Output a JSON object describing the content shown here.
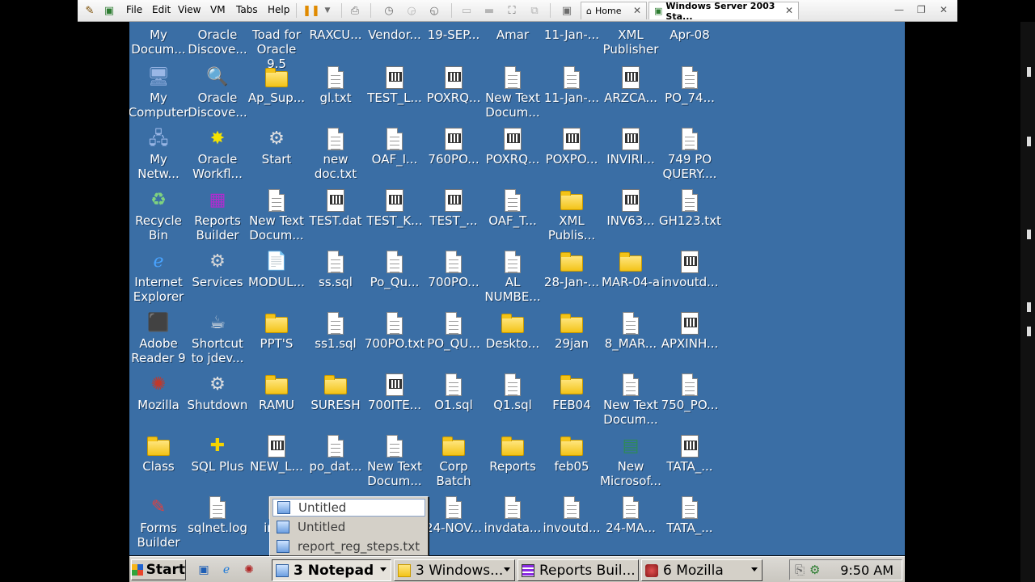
{
  "vm_window": {
    "menus": [
      "File",
      "Edit",
      "View",
      "VM",
      "Tabs",
      "Help"
    ],
    "tabs": [
      {
        "label": "Home"
      },
      {
        "label": "Windows Server 2003 Sta..."
      }
    ]
  },
  "desktop": {
    "icons": [
      {
        "label": "My\nDocum...",
        "icon": "my-documents-icon"
      },
      {
        "label": "Oracle\nDiscove...",
        "icon": "oracle-discoverer-icon"
      },
      {
        "label": "Toad for\nOracle 9.5",
        "icon": "toad-icon"
      },
      {
        "label": "RAXCU...",
        "icon": "file-icon"
      },
      {
        "label": "Vendor...",
        "icon": "file-icon"
      },
      {
        "label": "19-SEP...",
        "icon": "file-icon"
      },
      {
        "label": "Amar",
        "icon": "folder-icon"
      },
      {
        "label": "11-Jan-...",
        "icon": "file-icon"
      },
      {
        "label": "XML\nPublisher",
        "icon": "folder-icon"
      },
      {
        "label": "Apr-08",
        "icon": "folder-icon"
      },
      {
        "label": "My\nComputer",
        "icon": "my-computer-icon"
      },
      {
        "label": "Oracle\nDiscove...",
        "icon": "oracle-discoverer-icon"
      },
      {
        "label": "Ap_Sup...",
        "icon": "folder-icon"
      },
      {
        "label": "gl.txt",
        "icon": "text-file-icon"
      },
      {
        "label": "TEST_L...",
        "icon": "form-file-icon"
      },
      {
        "label": "POXRQ...",
        "icon": "form-file-icon"
      },
      {
        "label": "New Text\nDocum...",
        "icon": "text-file-icon"
      },
      {
        "label": "11-Jan-...",
        "icon": "text-file-icon"
      },
      {
        "label": "ARZCA...",
        "icon": "form-file-icon"
      },
      {
        "label": "PO_74...",
        "icon": "text-file-icon"
      },
      {
        "label": "My\nNetw...",
        "icon": "my-network-icon"
      },
      {
        "label": "Oracle\nWorkfl...",
        "icon": "oracle-workflow-icon"
      },
      {
        "label": "Start",
        "icon": "batch-file-icon"
      },
      {
        "label": "new\ndoc.txt",
        "icon": "text-file-icon"
      },
      {
        "label": "OAF_I...",
        "icon": "text-file-icon"
      },
      {
        "label": "760PO...",
        "icon": "form-file-icon"
      },
      {
        "label": "POXRQ...",
        "icon": "form-file-icon"
      },
      {
        "label": "POXPO...",
        "icon": "form-file-icon"
      },
      {
        "label": "INVIRI...",
        "icon": "form-file-icon"
      },
      {
        "label": "749 PO\nQUERY....",
        "icon": "text-file-icon"
      },
      {
        "label": "Recycle\nBin",
        "icon": "recycle-bin-icon"
      },
      {
        "label": "Reports\nBuilder",
        "icon": "reports-builder-icon"
      },
      {
        "label": "New Text\nDocum...",
        "icon": "text-file-icon"
      },
      {
        "label": "TEST.dat",
        "icon": "form-file-icon"
      },
      {
        "label": "TEST_K...",
        "icon": "form-file-icon"
      },
      {
        "label": "TEST_...",
        "icon": "form-file-icon"
      },
      {
        "label": "OAF_T...",
        "icon": "text-file-icon"
      },
      {
        "label": "XML\nPublis...",
        "icon": "folder-icon"
      },
      {
        "label": "INV63...",
        "icon": "form-file-icon"
      },
      {
        "label": "GH123.txt",
        "icon": "text-file-icon"
      },
      {
        "label": "Internet\nExplorer",
        "icon": "internet-explorer-icon"
      },
      {
        "label": "Services",
        "icon": "services-icon"
      },
      {
        "label": "MODUL...",
        "icon": "pdf-file-icon"
      },
      {
        "label": "ss.sql",
        "icon": "text-file-icon"
      },
      {
        "label": "Po_Qu...",
        "icon": "text-file-icon"
      },
      {
        "label": "700PO...",
        "icon": "text-file-icon"
      },
      {
        "label": "AL\nNUMBE...",
        "icon": "text-file-icon"
      },
      {
        "label": "28-Jan-...",
        "icon": "folder-icon"
      },
      {
        "label": "MAR-04-a",
        "icon": "folder-icon"
      },
      {
        "label": "invoutd...",
        "icon": "form-file-icon"
      },
      {
        "label": "Adobe\nReader 9",
        "icon": "adobe-reader-icon"
      },
      {
        "label": "Shortcut\nto jdev...",
        "icon": "jdev-shortcut-icon"
      },
      {
        "label": "PPT'S",
        "icon": "folder-icon"
      },
      {
        "label": "ss1.sql",
        "icon": "text-file-icon"
      },
      {
        "label": "700PO.txt",
        "icon": "text-file-icon"
      },
      {
        "label": "PO_QU...",
        "icon": "text-file-icon"
      },
      {
        "label": "Deskto...",
        "icon": "folder-icon"
      },
      {
        "label": "29jan",
        "icon": "folder-icon"
      },
      {
        "label": "8_MAR...",
        "icon": "text-file-icon"
      },
      {
        "label": "APXINH...",
        "icon": "form-file-icon"
      },
      {
        "label": "Mozilla",
        "icon": "mozilla-icon"
      },
      {
        "label": "Shutdown",
        "icon": "batch-file-icon"
      },
      {
        "label": "RAMU",
        "icon": "folder-icon"
      },
      {
        "label": "SURESH",
        "icon": "folder-icon"
      },
      {
        "label": "700ITE...",
        "icon": "form-file-icon"
      },
      {
        "label": "O1.sql",
        "icon": "text-file-icon"
      },
      {
        "label": "Q1.sql",
        "icon": "text-file-icon"
      },
      {
        "label": "FEB04",
        "icon": "folder-icon"
      },
      {
        "label": "New Text\nDocum...",
        "icon": "text-file-icon"
      },
      {
        "label": "750_PO...",
        "icon": "text-file-icon"
      },
      {
        "label": "Class",
        "icon": "folder-icon"
      },
      {
        "label": "SQL Plus",
        "icon": "sql-plus-icon"
      },
      {
        "label": "NEW_L...",
        "icon": "form-file-icon"
      },
      {
        "label": "po_dat...",
        "icon": "text-file-icon"
      },
      {
        "label": "New Text\nDocum...",
        "icon": "text-file-icon"
      },
      {
        "label": "Corp\nBatch",
        "icon": "folder-icon"
      },
      {
        "label": "Reports",
        "icon": "folder-icon"
      },
      {
        "label": "feb05",
        "icon": "folder-icon"
      },
      {
        "label": "New\nMicrosof...",
        "icon": "excel-file-icon"
      },
      {
        "label": "TATA_...",
        "icon": "form-file-icon"
      },
      {
        "label": "Forms\nBuilder",
        "icon": "forms-builder-icon"
      },
      {
        "label": "sqlnet.log",
        "icon": "text-file-icon"
      },
      {
        "label": "invo",
        "icon": "text-file-icon"
      },
      {
        "label": "",
        "icon": "hidden"
      },
      {
        "label": "",
        "icon": "hidden"
      },
      {
        "label": "24-NOV...",
        "icon": "text-file-icon"
      },
      {
        "label": "invdata...",
        "icon": "text-file-icon"
      },
      {
        "label": "invoutd...",
        "icon": "text-file-icon"
      },
      {
        "label": "24-MA...",
        "icon": "text-file-icon"
      },
      {
        "label": "TATA_...",
        "icon": "text-file-icon"
      }
    ]
  },
  "popup": {
    "items": [
      {
        "label": "Untitled"
      },
      {
        "label": "Untitled"
      },
      {
        "label": "report_reg_steps.txt"
      }
    ]
  },
  "taskbar": {
    "start_label": "Start",
    "buttons": [
      {
        "label": "3 Notepad",
        "pressed": true
      },
      {
        "label": "3 Windows...",
        "pressed": false
      },
      {
        "label": "Reports Buil...",
        "pressed": false
      },
      {
        "label": "6 Mozilla",
        "pressed": false
      }
    ],
    "clock": "9:50 AM"
  },
  "colors": {
    "desktop": "#3a6ea5",
    "taskbar": "#d4d0c8"
  }
}
